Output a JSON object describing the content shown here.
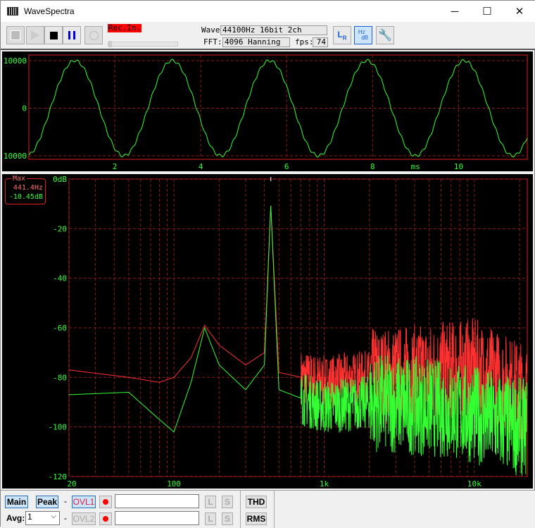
{
  "window": {
    "title": "WaveSpectra",
    "minimize": "─",
    "maximize": "☐",
    "close": "✕"
  },
  "toolbar": {
    "rec_label": "Rec.In.",
    "wave_label": "Wave:",
    "wave_value": "44100Hz 16bit 2ch",
    "fft_label": "FFT:",
    "fft_value": "4096 Hanning",
    "fps_label": "fps:",
    "fps_value": "74",
    "rec_level": 0.0
  },
  "wave_axis": {
    "y_ticks": [
      "10000",
      "0",
      "-10000"
    ],
    "x_ticks": [
      "2",
      "4",
      "6",
      "8",
      "10"
    ],
    "x_unit": "ms"
  },
  "spectrum_axis": {
    "y_ticks": [
      "0dB",
      "-20",
      "-40",
      "-60",
      "-80",
      "-100",
      "-120"
    ],
    "x_ticks": [
      "20",
      "100",
      "1k",
      "10k"
    ]
  },
  "marker": {
    "title": "Max",
    "freq": "441.4Hz",
    "level": "-10.45dB"
  },
  "colors": {
    "grid": "#8b1a1a",
    "frame": "#e02020",
    "wave": "#33ff33",
    "left": "#33ff33",
    "right": "#ff3030",
    "label": "#33ff33"
  },
  "chart_data": [
    {
      "type": "line",
      "title": "Waveform",
      "xlabel": "ms",
      "xlim": [
        0,
        11.6
      ],
      "ylim": [
        -11000,
        11000
      ],
      "signal": {
        "freq_hz": 441.4,
        "amplitude": 10000
      }
    },
    {
      "type": "line",
      "title": "Spectrum",
      "xscale": "log",
      "xlim": [
        20,
        22500
      ],
      "ylim": [
        -120,
        0
      ],
      "series": [
        {
          "name": "R",
          "x": [
            20,
            50,
            80,
            100,
            130,
            160,
            200,
            300,
            400,
            441,
            500,
            1000,
            2000,
            5000,
            10000,
            20000
          ],
          "y": [
            -77,
            -80,
            -82,
            -80,
            -72,
            -59,
            -67,
            -75,
            -70,
            -10.45,
            -78,
            -82,
            -80,
            -78,
            -76,
            -85
          ]
        },
        {
          "name": "L",
          "x": [
            20,
            50,
            80,
            100,
            130,
            160,
            200,
            300,
            400,
            441,
            500,
            1000,
            2000,
            5000,
            10000,
            20000
          ],
          "y": [
            -87,
            -86,
            -97,
            -102,
            -82,
            -60,
            -75,
            -85,
            -75,
            -10.45,
            -85,
            -92,
            -90,
            -92,
            -95,
            -100
          ]
        }
      ]
    }
  ],
  "bottom": {
    "main": "Main",
    "peak": "Peak",
    "dash": "-",
    "ovl1": "OVL1",
    "ovl2": "OVL2",
    "avg_label": "Avg:",
    "avg_value": "1",
    "l": "L",
    "s": "S",
    "thd": "THD",
    "rms": "RMS"
  }
}
